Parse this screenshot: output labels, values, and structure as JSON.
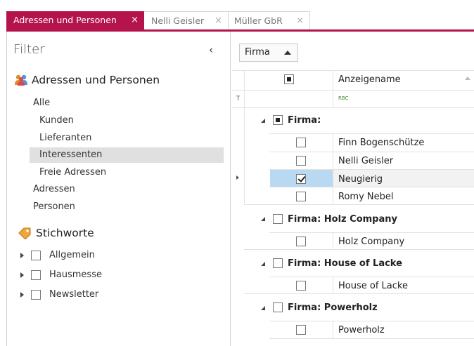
{
  "tabs": [
    {
      "label": "Adressen und Personen",
      "close": "×"
    },
    {
      "label": "Nelli Geisler",
      "close": "×"
    },
    {
      "label": "Müller GbR",
      "close": "×"
    }
  ],
  "filter": {
    "title": "Filter",
    "collapse_glyph": "‹",
    "section_contacts": "Adressen und Personen",
    "nav": [
      {
        "label": "Alle"
      },
      {
        "label": "Kunden"
      },
      {
        "label": "Lieferanten"
      },
      {
        "label": "Interessenten"
      },
      {
        "label": "Freie Adressen"
      },
      {
        "label": "Adressen"
      },
      {
        "label": "Personen"
      }
    ],
    "selected_item": "Interessenten",
    "section_tags": "Stichworte",
    "tags": [
      {
        "label": "Allgemein"
      },
      {
        "label": "Hausmesse"
      },
      {
        "label": "Newsletter"
      }
    ]
  },
  "grid": {
    "group_chip": "Firma",
    "column_header": "Anzeigename",
    "filter_row_icon": "RBC",
    "filter_glyph": "T",
    "groups": [
      {
        "label": "Firma:",
        "rows": [
          {
            "name": "Finn Bogenschütze",
            "checked": false
          },
          {
            "name": "Nelli Geisler",
            "checked": false
          },
          {
            "name": "Neugierig",
            "checked": true
          },
          {
            "name": "Romy Nebel",
            "checked": false
          }
        ]
      },
      {
        "label": "Firma: Holz Company",
        "rows": [
          {
            "name": "Holz Company",
            "checked": false
          }
        ]
      },
      {
        "label": "Firma: House of Lacke",
        "rows": [
          {
            "name": "House of Lacke",
            "checked": false
          }
        ]
      },
      {
        "label": "Firma: Powerholz",
        "rows": [
          {
            "name": "Powerholz",
            "checked": false
          }
        ]
      }
    ]
  },
  "colors": {
    "accent": "#b5134b",
    "selected_row": "#b9d8f2",
    "selected_nav": "#e0e0e0"
  }
}
